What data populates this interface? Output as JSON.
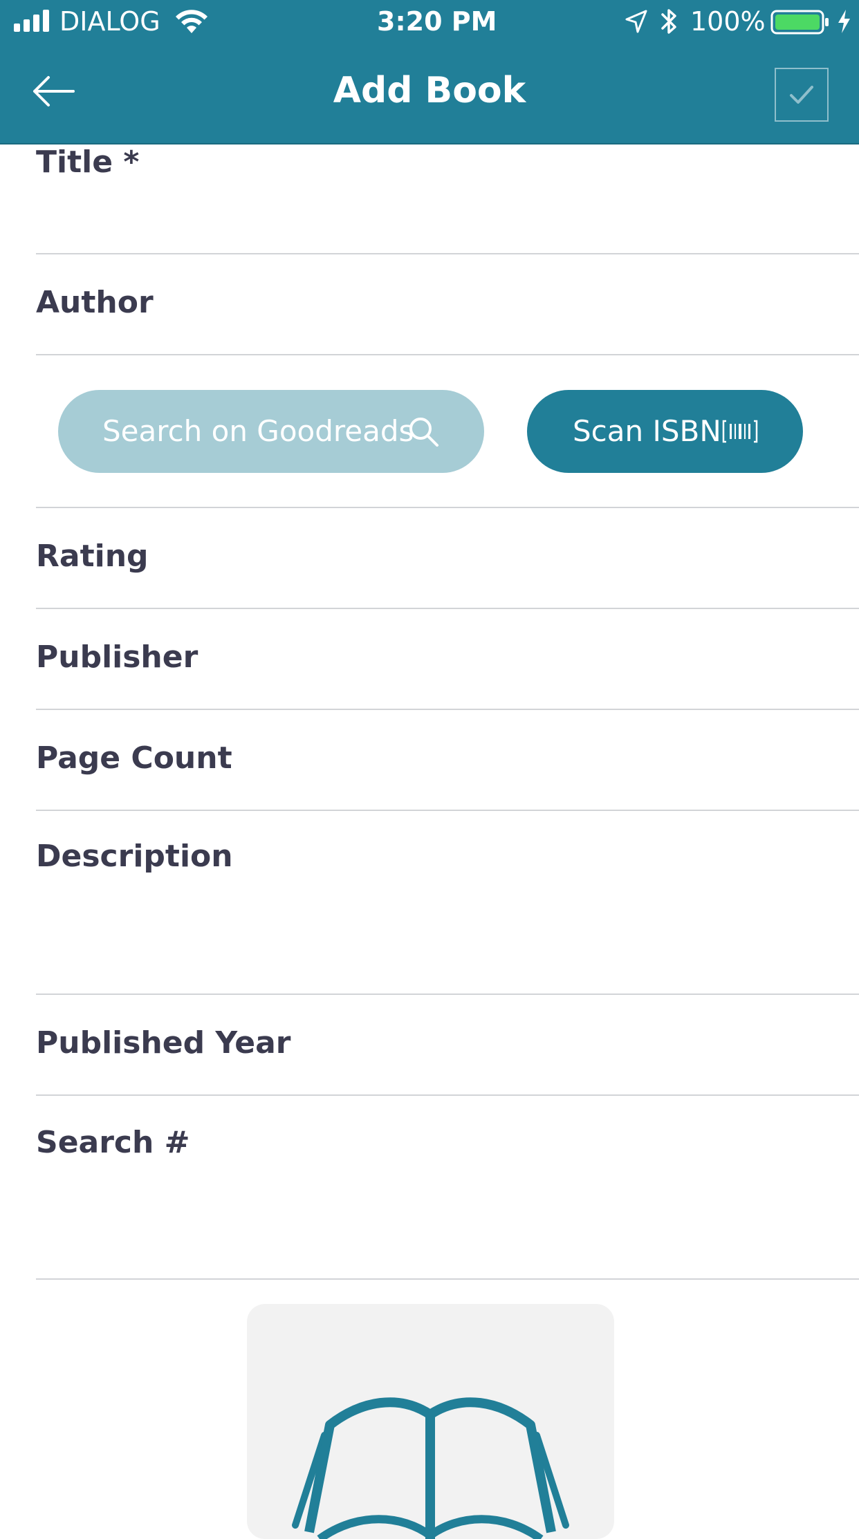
{
  "status_bar": {
    "carrier": "DIALOG",
    "time": "3:20 PM",
    "battery": "100%"
  },
  "header": {
    "title": "Add Book"
  },
  "fields": {
    "title": "Title *",
    "author": "Author",
    "rating": "Rating",
    "publisher": "Publisher",
    "page_count": "Page Count",
    "description": "Description",
    "published_year": "Published Year",
    "search_number": "Search #"
  },
  "buttons": {
    "search_goodreads": "Search on Goodreads",
    "scan_isbn": "Scan ISBN"
  },
  "colors": {
    "primary": "#217f98",
    "primary_light": "#a6ccd5",
    "label_text": "#3b3b4f",
    "divider": "#d2d4d7",
    "battery_fill": "#4cd964"
  }
}
